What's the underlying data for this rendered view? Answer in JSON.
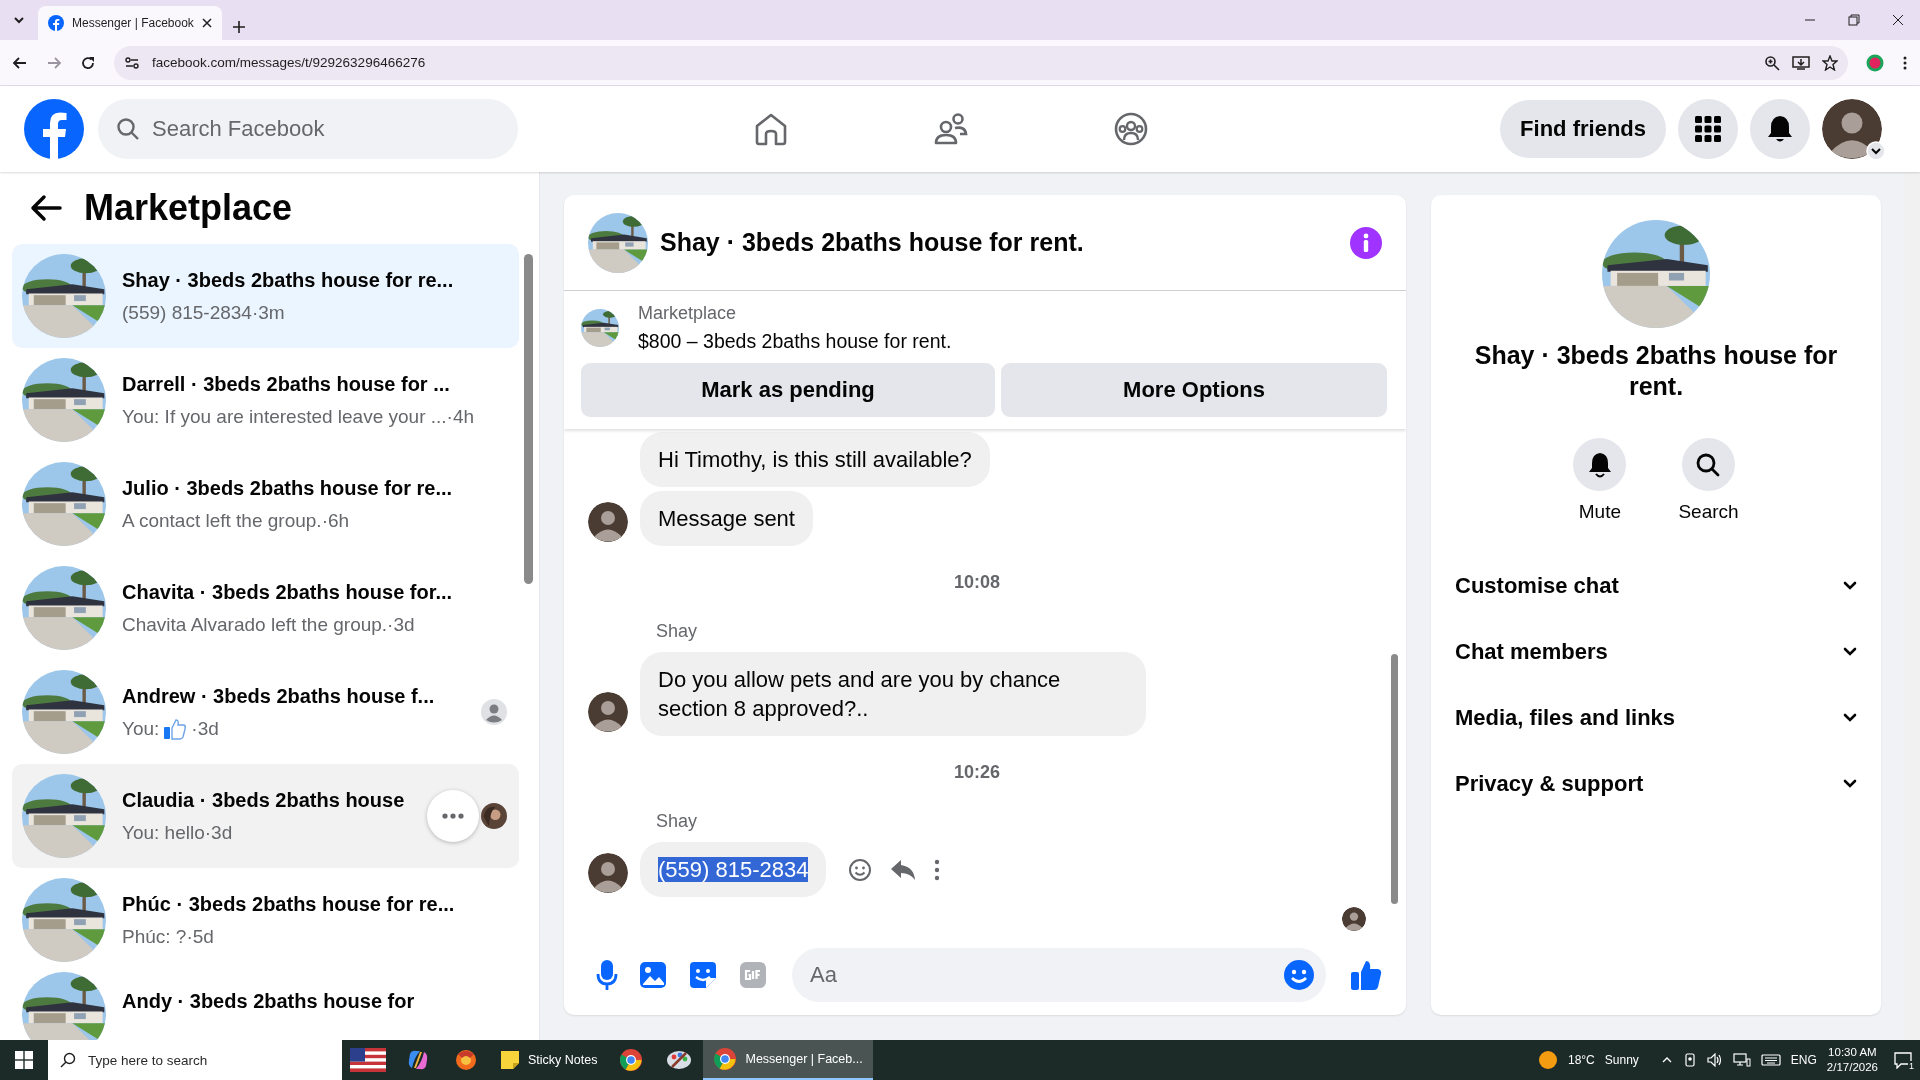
{
  "browser": {
    "tab_title": "Messenger | Facebook",
    "url": "facebook.com/messages/t/929263296466276"
  },
  "header": {
    "search_placeholder": "Search Facebook",
    "find_friends": "Find friends"
  },
  "sidebar": {
    "title": "Marketplace",
    "conversations": [
      {
        "title": "Shay · 3beds 2baths house for re...",
        "preview": "(559) 815-2834",
        "time": "·3m",
        "selected": true,
        "hovered": false
      },
      {
        "title": "Darrell · 3beds 2baths house for ...",
        "preview": "You: If you are interested leave your ...",
        "time": "·4h",
        "selected": false,
        "hovered": false
      },
      {
        "title": "Julio · 3beds 2baths house for re...",
        "preview": "A contact left the group.",
        "time": "·6h",
        "selected": false,
        "hovered": false
      },
      {
        "title": "Chavita · 3beds 2baths house for...",
        "preview": "Chavita Alvarado left the group.",
        "time": "·3d",
        "selected": false,
        "hovered": false
      },
      {
        "title": "Andrew · 3beds 2baths house f...",
        "preview": "You:",
        "preview_icon": {
          "kind": "like"
        },
        "time": "·3d",
        "seen": {
          "kind": "generic"
        },
        "selected": false,
        "hovered": false
      },
      {
        "title": "Claudia · 3beds 2baths house",
        "preview": "You: hello",
        "time": "·3d",
        "selected": false,
        "hovered": true
      },
      {
        "title": "Phúc · 3beds 2baths house for re...",
        "preview": "Phúc: ?",
        "time": "·5d",
        "selected": false,
        "hovered": false
      },
      {
        "title": "Andy · 3beds 2baths house for",
        "selected": false,
        "hovered": false
      }
    ]
  },
  "chat": {
    "title": "Shay · 3beds 2baths house for rent.",
    "listing": {
      "label": "Marketplace",
      "text": "$800 – 3beds 2baths house for rent."
    },
    "buttons": [
      "Mark as pending",
      "More Options"
    ],
    "messages": [
      {
        "kind": "bubble",
        "text": "Hi Timothy, is this still available?",
        "avatar": false,
        "highlighted": false,
        "actions": false
      },
      {
        "kind": "bubble",
        "text": "Message sent",
        "avatar": true,
        "highlighted": false,
        "actions": false
      },
      {
        "kind": "time",
        "text": "10:08"
      },
      {
        "kind": "bubble",
        "sender": "Shay",
        "text": "Do you allow pets and are you by chance section 8 approved?..",
        "avatar": true,
        "highlighted": false,
        "actions": false
      },
      {
        "kind": "time",
        "text": "10:26"
      },
      {
        "kind": "bubble",
        "sender": "Shay",
        "text": "(559) 815-2834",
        "avatar": true,
        "highlighted": true,
        "actions": true
      }
    ],
    "composer_placeholder": "Aa"
  },
  "details": {
    "title": "Shay · 3beds 2baths house for rent.",
    "actions": [
      {
        "kind": "mute",
        "label": "Mute"
      },
      {
        "kind": "search",
        "label": "Search"
      }
    ],
    "sections": [
      {
        "label": "Customise chat",
        "expanded": false
      },
      {
        "label": "Chat members",
        "expanded": false
      },
      {
        "label": "Media, files and links",
        "expanded": false
      },
      {
        "label": "Privacy & support",
        "expanded": false
      }
    ]
  },
  "taskbar": {
    "search_placeholder": "Type here to search",
    "apps": [
      {
        "kind": "flag",
        "selected": false
      },
      {
        "kind": "copilot",
        "selected": false
      },
      {
        "kind": "browser",
        "selected": false
      },
      {
        "kind": "notes",
        "label": "Sticky Notes",
        "selected": false
      },
      {
        "kind": "chrome",
        "selected": false
      },
      {
        "kind": "paint",
        "selected": false
      },
      {
        "kind": "chrome",
        "label": "Messenger | Faceb...",
        "selected": true
      }
    ],
    "weather": {
      "temp": "18°C",
      "condition": "Sunny"
    },
    "language": "ENG",
    "time": "10:30 AM",
    "date": "2/17/2026",
    "notifications": "1"
  }
}
